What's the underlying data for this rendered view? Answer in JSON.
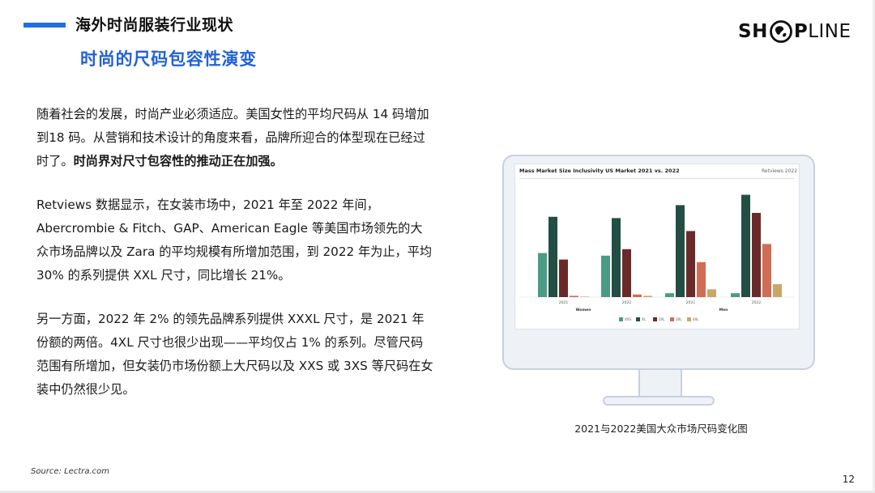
{
  "header": {
    "section_title": "海外时尚服装行业现状",
    "subtitle": "时尚的尺码包容性演变"
  },
  "logo": {
    "part1": "SH",
    "part2": "P",
    "part3": "LINE"
  },
  "body": {
    "p1_text": "随着社会的发展，时尚产业必须适应。美国女性的平均尺码从 14 码增加到18 码。从营销和技术设计的角度来看，品牌所迎合的体型现在已经过时了。",
    "p1_bold": "时尚界对尺寸包容性的推动正在加强。",
    "p2": "Retviews 数据显示，在女装市场中，2021 年至 2022 年间，Abercrombie & Fitch、GAP、American Eagle 等美国市场领先的大众市场品牌以及 Zara 的平均规模有所增加范围，到 2022 年为止，平均 30% 的系列提供 XXL 尺寸，同比增长 21%。",
    "p3": "另一方面，2022 年 2% 的领先品牌系列提供 XXXL 尺寸，是 2021 年份额的两倍。4XL 尺寸也很少出现——平均仅占 1% 的系列。尽管尺码范围有所增加，但女装仍市场份额上大尺码以及 XXS 或 3XS 等尺码在女装中仍然很少见。"
  },
  "source": "Source:  Lectra.com",
  "page_number": "12",
  "caption": "2021与2022美国大众市场尺码变化图",
  "colors": {
    "accent": "#1f6fe0",
    "subtitle": "#2262d6"
  },
  "chart_data": {
    "type": "bar",
    "title": "Mass Market Size Inclusivity US Market 2021 vs. 2022",
    "brand": "Retviews 2022",
    "categories": [
      "2021",
      "2022",
      "2021",
      "2022"
    ],
    "groups": [
      "Women",
      "Women",
      "Men",
      "Men"
    ],
    "group_labels": [
      "Women",
      "Men"
    ],
    "series": [
      {
        "name": "XXS",
        "color": "#4a9b84",
        "values": [
          34,
          32,
          3,
          3
        ]
      },
      {
        "name": "XL",
        "color": "#234e44",
        "values": [
          62,
          61,
          71,
          79
        ]
      },
      {
        "name": "2XL",
        "color": "#6b2a2a",
        "values": [
          29,
          37,
          51,
          65
        ]
      },
      {
        "name": "3XL",
        "color": "#d06d55",
        "values": [
          1,
          2,
          27,
          41
        ]
      },
      {
        "name": "4XL",
        "color": "#caa668",
        "values": [
          0,
          1,
          6,
          10
        ]
      }
    ],
    "ylim": [
      0,
      80
    ]
  }
}
